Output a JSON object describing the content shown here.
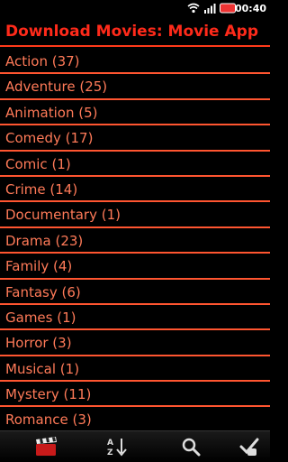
{
  "status": {
    "time": "00:40"
  },
  "header": {
    "title": "Download Movies: Movie App"
  },
  "genres": [
    {
      "label": "Action (37)"
    },
    {
      "label": "Adventure (25)"
    },
    {
      "label": "Animation (5)"
    },
    {
      "label": "Comedy (17)"
    },
    {
      "label": "Comic (1)"
    },
    {
      "label": "Crime (14)"
    },
    {
      "label": "Documentary (1)"
    },
    {
      "label": "Drama (23)"
    },
    {
      "label": "Family (4)"
    },
    {
      "label": "Fantasy (6)"
    },
    {
      "label": "Games (1)"
    },
    {
      "label": "Horror (3)"
    },
    {
      "label": "Musical (1)"
    },
    {
      "label": "Mystery (11)"
    },
    {
      "label": "Romance (3)"
    }
  ],
  "toolbar": {
    "items": [
      {
        "icon": "clapperboard-icon"
      },
      {
        "icon": "sort-az-icon"
      },
      {
        "icon": "search-icon"
      },
      {
        "icon": "checkmark-hand-icon"
      }
    ]
  },
  "colors": {
    "accent": "#ff2a1a",
    "text": "#ff7a58",
    "divider": "#ff5530",
    "background": "#000000"
  }
}
